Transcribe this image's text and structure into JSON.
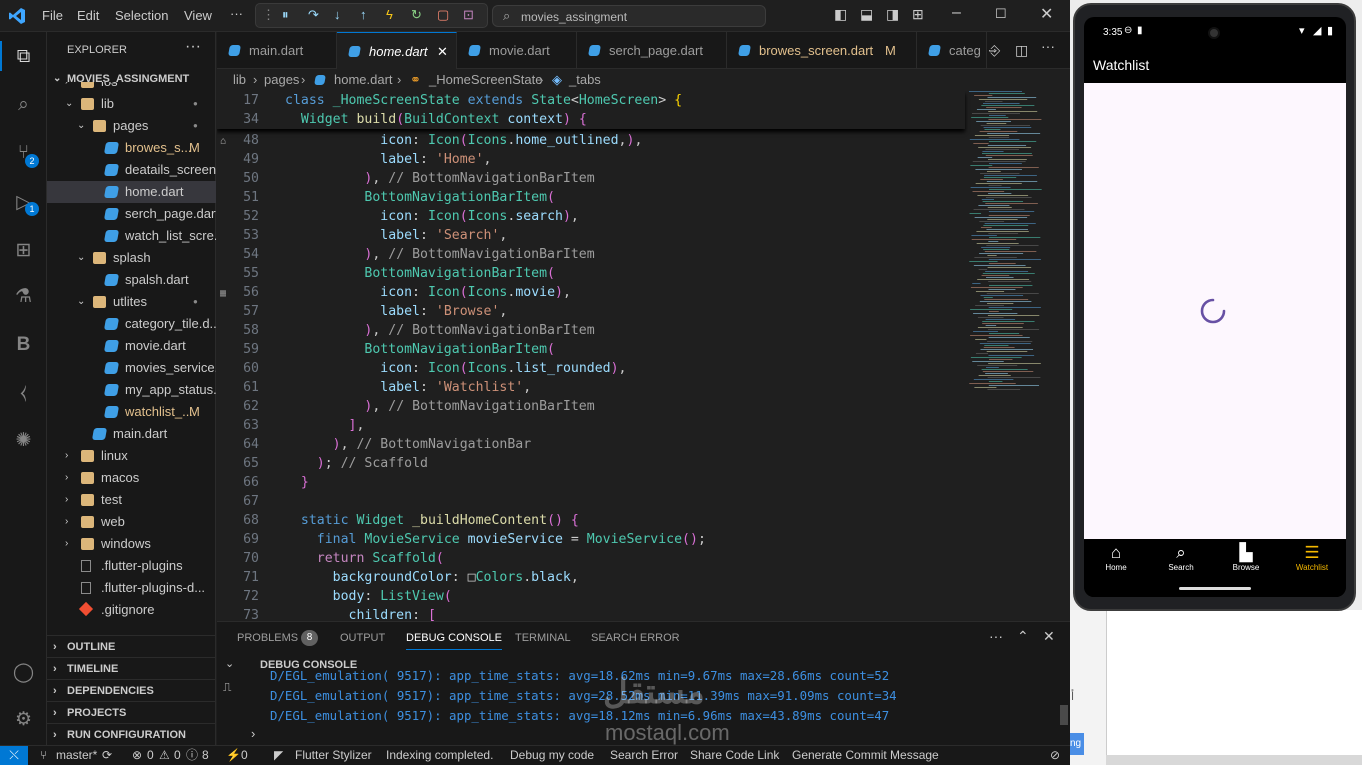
{
  "titlebar": {
    "menus": [
      "File",
      "Edit",
      "Selection",
      "View",
      "···"
    ],
    "search_text": "movies_assingment",
    "window_buttons": [
      "minimize",
      "maximize",
      "close"
    ]
  },
  "activity_badges": {
    "source_control": "2",
    "run_debug": "1"
  },
  "explorer": {
    "title": "EXPLORER",
    "root": "MOVIES_ASSINGMENT",
    "items": [
      {
        "label": "ios",
        "depth": 1,
        "type": "folder"
      },
      {
        "label": "lib",
        "depth": 1,
        "type": "folder-open"
      },
      {
        "label": "pages",
        "depth": 2,
        "type": "folder-open"
      },
      {
        "label": "browes_s...",
        "depth": 3,
        "type": "dart",
        "status": "M"
      },
      {
        "label": "deatails_screen...",
        "depth": 3,
        "type": "dart"
      },
      {
        "label": "home.dart",
        "depth": 3,
        "type": "dart",
        "selected": true
      },
      {
        "label": "serch_page.dart",
        "depth": 3,
        "type": "dart"
      },
      {
        "label": "watch_list_scre...",
        "depth": 3,
        "type": "dart"
      },
      {
        "label": "splash",
        "depth": 2,
        "type": "folder-open"
      },
      {
        "label": "spalsh.dart",
        "depth": 3,
        "type": "dart"
      },
      {
        "label": "utlites",
        "depth": 2,
        "type": "folder-open"
      },
      {
        "label": "category_tile.d...",
        "depth": 3,
        "type": "dart"
      },
      {
        "label": "movie.dart",
        "depth": 3,
        "type": "dart"
      },
      {
        "label": "movies_service...",
        "depth": 3,
        "type": "dart"
      },
      {
        "label": "my_app_status....",
        "depth": 3,
        "type": "dart"
      },
      {
        "label": "watchlist_...",
        "depth": 3,
        "type": "dart",
        "status": "M"
      },
      {
        "label": "main.dart",
        "depth": 2,
        "type": "dart"
      },
      {
        "label": "linux",
        "depth": 1,
        "type": "folder"
      },
      {
        "label": "macos",
        "depth": 1,
        "type": "folder"
      },
      {
        "label": "test",
        "depth": 1,
        "type": "folder"
      },
      {
        "label": "web",
        "depth": 1,
        "type": "folder"
      },
      {
        "label": "windows",
        "depth": 1,
        "type": "folder"
      },
      {
        "label": ".flutter-plugins",
        "depth": 1,
        "type": "file"
      },
      {
        "label": ".flutter-plugins-d...",
        "depth": 1,
        "type": "file"
      },
      {
        "label": ".gitignore",
        "depth": 1,
        "type": "git"
      }
    ],
    "sections": [
      "OUTLINE",
      "TIMELINE",
      "DEPENDENCIES",
      "PROJECTS",
      "RUN CONFIGURATION"
    ]
  },
  "tabs": [
    {
      "label": "main.dart"
    },
    {
      "label": "home.dart",
      "active": true
    },
    {
      "label": "movie.dart"
    },
    {
      "label": "serch_page.dart"
    },
    {
      "label": "browes_screen.dart",
      "status": "M"
    },
    {
      "label": "categ"
    }
  ],
  "breadcrumb": [
    "lib",
    "pages",
    "home.dart",
    "_HomeScreenState",
    "_tabs"
  ],
  "sticky": [
    {
      "n": "17",
      "code": "class _HomeScreenState extends State<HomeScreen> {"
    },
    {
      "n": "34",
      "code": "  Widget build(BuildContext context) {"
    }
  ],
  "code_lines": [
    {
      "n": "48",
      "code": "            icon: Icon(Icons.home_outlined,),"
    },
    {
      "n": "49",
      "code": "            label: 'Home',"
    },
    {
      "n": "50",
      "code": "          ), // BottomNavigationBarItem"
    },
    {
      "n": "51",
      "code": "          BottomNavigationBarItem("
    },
    {
      "n": "52",
      "code": "            icon: Icon(Icons.search),"
    },
    {
      "n": "53",
      "code": "            label: 'Search',"
    },
    {
      "n": "54",
      "code": "          ), // BottomNavigationBarItem"
    },
    {
      "n": "55",
      "code": "          BottomNavigationBarItem("
    },
    {
      "n": "56",
      "code": "            icon: Icon(Icons.movie),"
    },
    {
      "n": "57",
      "code": "            label: 'Browse',"
    },
    {
      "n": "58",
      "code": "          ), // BottomNavigationBarItem"
    },
    {
      "n": "59",
      "code": "          BottomNavigationBarItem("
    },
    {
      "n": "60",
      "code": "            icon: Icon(Icons.list_rounded),"
    },
    {
      "n": "61",
      "code": "            label: 'Watchlist',"
    },
    {
      "n": "62",
      "code": "          ), // BottomNavigationBarItem"
    },
    {
      "n": "63",
      "code": "        ],"
    },
    {
      "n": "64",
      "code": "      ), // BottomNavigationBar"
    },
    {
      "n": "65",
      "code": "    ); // Scaffold"
    },
    {
      "n": "66",
      "code": "  }"
    },
    {
      "n": "67",
      "code": ""
    },
    {
      "n": "68",
      "code": "  static Widget _buildHomeContent() {"
    },
    {
      "n": "69",
      "code": "    final MovieService movieService = MovieService();"
    },
    {
      "n": "70",
      "code": "    return Scaffold("
    },
    {
      "n": "71",
      "code": "      backgroundColor: □Colors.black,"
    },
    {
      "n": "72",
      "code": "      body: ListView("
    },
    {
      "n": "73",
      "code": "        children: ["
    }
  ],
  "panel": {
    "tabs": [
      "PROBLEMS",
      "OUTPUT",
      "DEBUG CONSOLE",
      "TERMINAL",
      "SEARCH ERROR"
    ],
    "problems_count": "8",
    "active_tab": "DEBUG CONSOLE",
    "console_title": "DEBUG CONSOLE",
    "logs": [
      "D/EGL_emulation( 9517): app_time_stats: avg=18.62ms min=9.67ms max=28.66ms count=52",
      "D/EGL_emulation( 9517): app_time_stats: avg=28.52ms min=11.39ms max=91.09ms count=34",
      "D/EGL_emulation( 9517): app_time_stats: avg=18.12ms min=6.96ms max=43.89ms count=47"
    ]
  },
  "statusbar": {
    "branch": "master*",
    "errors": "0",
    "warnings_a": "0",
    "warnings_b": "0",
    "info": "8",
    "ports": "0",
    "items": [
      "Flutter Stylizer",
      "Indexing completed.",
      "Debug my code",
      "Search Error",
      "Share Code Link",
      "Generate Commit Message"
    ]
  },
  "phone": {
    "time": "3:35",
    "app_title": "Watchlist",
    "nav": [
      {
        "label": "Home",
        "icon": "home-icon"
      },
      {
        "label": "Search",
        "icon": "search-icon"
      },
      {
        "label": "Browse",
        "icon": "movie-icon"
      },
      {
        "label": "Watchlist",
        "icon": "list-icon",
        "active": true
      }
    ],
    "accent": "#f5b800",
    "spinner_color": "#6750a4"
  },
  "watermark": {
    "arabic": "مستقل",
    "latin": "mostaql.com"
  },
  "behind_window": {
    "text": "ng",
    "char": "أ"
  }
}
